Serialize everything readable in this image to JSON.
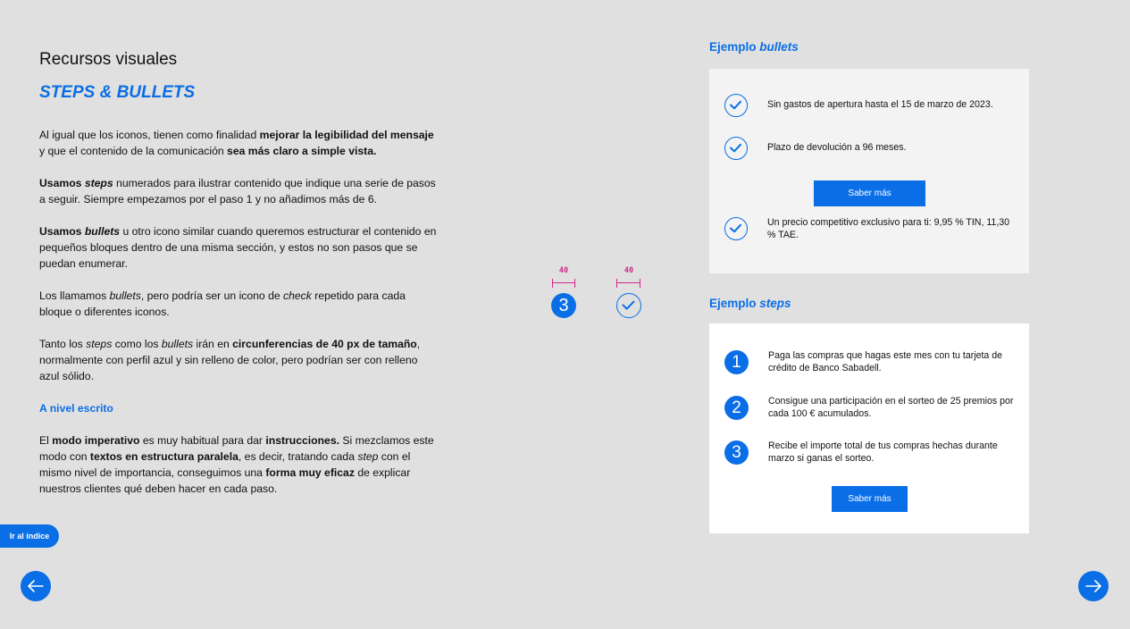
{
  "section_title": "Recursos visuales",
  "subtitle": "STEPS & BULLETS",
  "paragraphs": {
    "p1": {
      "a": "Al igual que los iconos, tienen como finalidad ",
      "b": "mejorar la legibilidad del mensaje",
      "c": " y que el contenido de la comunicación ",
      "d": "sea más claro a simple vista."
    },
    "p2": {
      "a": "Usamos ",
      "b": "steps",
      "c": " numerados para ilustrar contenido que indique una serie de pasos a seguir. Siempre empezamos por el paso 1 y no añadimos más de 6."
    },
    "p3": {
      "a": "Usamos ",
      "b": "bullets",
      "c": " u otro icono similar cuando queremos estructurar el contenido en pequeños bloques dentro de una misma sección, y estos no son pasos que se puedan enumerar."
    },
    "p4": {
      "a": "Los llamamos ",
      "b": "bullets",
      "c": ", pero podría ser un icono de ",
      "d": "check",
      "e": " repetido para cada bloque o diferentes iconos."
    },
    "p5": {
      "a": "Tanto los ",
      "b": "steps",
      "c": " como los ",
      "d": "bullets",
      "e": " irán en ",
      "f": "circunferencias de 40 px de tamaño",
      "g": ", normalmente con perfil azul y sin relleno de color, pero podrían ser con relleno azul sólido."
    },
    "written_heading": "A nivel escrito",
    "p6": {
      "a": "El ",
      "b": "modo imperativo",
      "c": " es muy habitual para dar ",
      "d": "instrucciones.",
      "e": " Si mezclamos este modo con ",
      "f": "textos en estructura paralela",
      "g": ", es decir, tratando cada ",
      "h": "step",
      "i": " con el mismo nivel de importancia, conseguimos una ",
      "j": "forma muy eficaz",
      "k": " de explicar nuestros clientes qué deben hacer en cada paso."
    }
  },
  "demo": {
    "dim_label_1": "40",
    "dim_label_2": "40",
    "step_number": "3",
    "step_icon": "step-number-filled",
    "check_icon": "check-circle-outline"
  },
  "bullets_example": {
    "title_a": "Ejemplo ",
    "title_b": "bullets",
    "items": [
      "Sin gastos de apertura hasta el 15 de marzo de 2023.",
      "Plazo de devolución a 96 meses.",
      "Un precio competitivo exclusivo para ti: 9,95 % TIN, 11,30 % TAE."
    ],
    "button": "Saber más"
  },
  "steps_example": {
    "title_a": "Ejemplo ",
    "title_b": "steps",
    "items": [
      {
        "num": "1",
        "text": "Paga las compras que hagas este mes con tu tarjeta de crédito de Banco Sabadell."
      },
      {
        "num": "2",
        "text": "Consigue una participación en el sorteo de 25 premios por cada 100 € acumulados."
      },
      {
        "num": "3",
        "text": "Recibe el importe total de tus compras hechas durante marzo si ganas el sorteo."
      }
    ],
    "button": "Saber más"
  },
  "index_button": "Ir al índice",
  "nav": {
    "prev_icon": "arrow-left-icon",
    "next_icon": "arrow-right-icon"
  },
  "colors": {
    "accent": "#0a6ee6",
    "background": "#e0e0e0",
    "dimension": "#d0288a"
  }
}
